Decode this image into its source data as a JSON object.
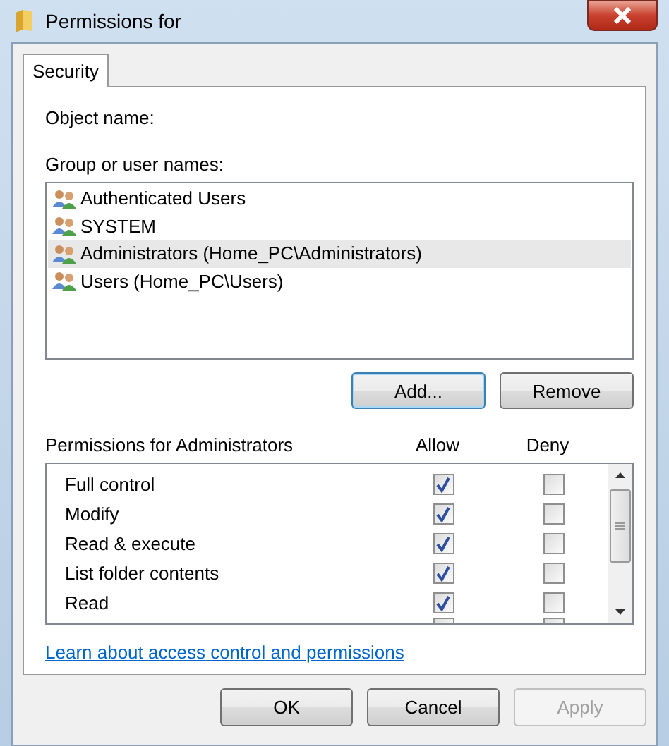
{
  "window": {
    "title": "Permissions for"
  },
  "tabs": [
    {
      "label": "Security",
      "selected": true
    }
  ],
  "object_name": {
    "label": "Object name:"
  },
  "groups": {
    "label": "Group or user names:",
    "items": [
      {
        "name": "Authenticated Users",
        "selected": false
      },
      {
        "name": "SYSTEM",
        "selected": false
      },
      {
        "name": "Administrators (Home_PC\\Administrators)",
        "selected": true
      },
      {
        "name": "Users (Home_PC\\Users)",
        "selected": false
      }
    ]
  },
  "group_buttons": [
    {
      "label": "Add...",
      "focused": true
    },
    {
      "label": "Remove",
      "focused": false
    }
  ],
  "permissions": {
    "label": "Permissions for Administrators",
    "allow_label": "Allow",
    "deny_label": "Deny",
    "rows": [
      {
        "name": "Full control",
        "allow": true,
        "deny": false
      },
      {
        "name": "Modify",
        "allow": true,
        "deny": false
      },
      {
        "name": "Read & execute",
        "allow": true,
        "deny": false
      },
      {
        "name": "List folder contents",
        "allow": true,
        "deny": false
      },
      {
        "name": "Read",
        "allow": true,
        "deny": false
      }
    ]
  },
  "link": "Learn about access control and permissions",
  "buttons": [
    {
      "label": "OK",
      "disabled": false
    },
    {
      "label": "Cancel",
      "disabled": false
    },
    {
      "label": "Apply",
      "disabled": true
    }
  ]
}
